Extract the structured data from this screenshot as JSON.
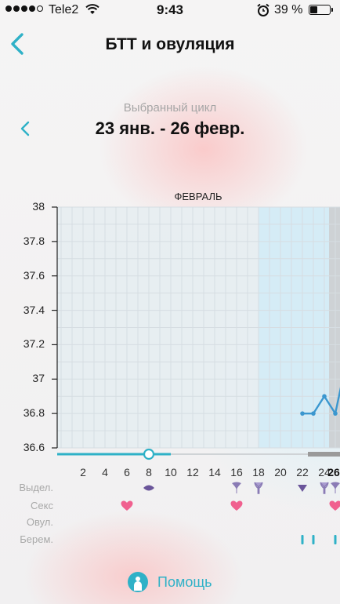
{
  "status_bar": {
    "carrier": "Tele2",
    "time": "9:43",
    "battery": "39 %",
    "signal_dots_filled": 4,
    "signal_dots_total": 5,
    "battery_level": 0.39
  },
  "header": {
    "title": "БТТ и овуляция",
    "back_icon": "chevron-left-icon"
  },
  "cycle": {
    "caption": "Выбранный цикл",
    "range": "23 янв. - 26 февр.",
    "prev_icon": "chevron-left-icon"
  },
  "chart_data": {
    "type": "line",
    "title": "ФЕВРАЛЬ",
    "xlabel": "",
    "ylabel": "",
    "ylim": [
      36.6,
      38
    ],
    "xlim": [
      0,
      26.5
    ],
    "grid": true,
    "y_ticks": [
      "38",
      "37.8",
      "37.6",
      "37.4",
      "37.2",
      "37",
      "36.8",
      "36.6"
    ],
    "x_ticks": [
      "2",
      "4",
      "6",
      "8",
      "10",
      "12",
      "14",
      "16",
      "18",
      "20",
      "22",
      "24",
      "26"
    ],
    "highlighted_x_tick": "26",
    "series": [
      {
        "x": [
          22,
          23,
          24,
          25,
          26
        ],
        "y": [
          36.8,
          36.8,
          36.9,
          36.8,
          37.1
        ],
        "color": "#3b97cf"
      }
    ],
    "colors": {
      "line": "#3b97cf",
      "grid": "#d6dde2",
      "plot_bg": "#e6eef1",
      "ovulation_band": "#d3ebf6"
    }
  },
  "slider": {
    "position_day": 8,
    "range_start_day": 0,
    "range_end_day": 10,
    "selected_end_from_day": 22.5,
    "color": "#2fb1c7"
  },
  "tracker_rows": [
    {
      "label": "Выдел.",
      "marks": [
        {
          "day": 8,
          "icon": "eye-discharge-icon"
        },
        {
          "day": 16,
          "icon": "discharge-drop-icon"
        },
        {
          "day": 18,
          "icon": "discharge-split-icon"
        },
        {
          "day": 22,
          "icon": "discharge-diamond-icon"
        },
        {
          "day": 24,
          "icon": "discharge-split-icon"
        },
        {
          "day": 25,
          "icon": "discharge-drop-icon"
        }
      ]
    },
    {
      "label": "Секс",
      "marks": [
        {
          "day": 6,
          "icon": "heart-icon"
        },
        {
          "day": 16,
          "icon": "heart-icon"
        },
        {
          "day": 25,
          "icon": "heart-icon"
        }
      ]
    },
    {
      "label": "Овул.",
      "marks": []
    },
    {
      "label": "Берем.",
      "marks": [
        {
          "day": 22,
          "icon": "test-strip-icon"
        },
        {
          "day": 23,
          "icon": "test-strip-icon"
        },
        {
          "day": 25,
          "icon": "test-strip-icon"
        }
      ]
    }
  ],
  "help": {
    "label": "Помощь",
    "icon": "help-person-icon"
  }
}
